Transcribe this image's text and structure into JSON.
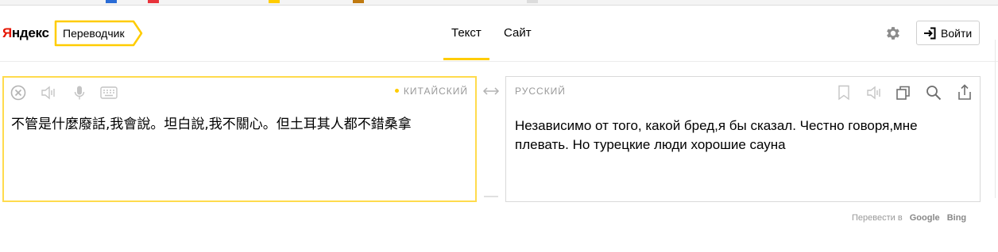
{
  "header": {
    "logo": {
      "first": "Я",
      "rest": "ндекс"
    },
    "service_name": "Переводчик",
    "tabs": [
      {
        "label": "Текст",
        "active": true
      },
      {
        "label": "Сайт",
        "active": false
      }
    ],
    "settings_icon": "gear-icon",
    "login_label": "Войти",
    "login_icon": "login-arrow-icon"
  },
  "source": {
    "language": "КИТАЙСКИЙ",
    "text": "不管是什麼廢話,我會說。坦白說,我不關心。但土耳其人都不錯桑拿",
    "icons": [
      "clear-icon",
      "listen-icon",
      "microphone-icon",
      "keyboard-icon"
    ]
  },
  "swap_icon": "swap-arrows-icon",
  "target": {
    "language": "РУССКИЙ",
    "text": "Независимо от того, какой бред,я бы сказал. Честно говоря,мне плевать. Но турецкие люди хорошие сауна",
    "icons": [
      "bookmark-icon",
      "listen-icon",
      "copy-icon",
      "search-icon",
      "share-icon"
    ]
  },
  "footer": {
    "prefix": "Перевести в",
    "google": "Google",
    "bing": "Bing"
  },
  "colors": {
    "accent": "#ffcc00",
    "logo_red": "#e61400",
    "border": "#d9d9d9",
    "muted": "#999999"
  }
}
